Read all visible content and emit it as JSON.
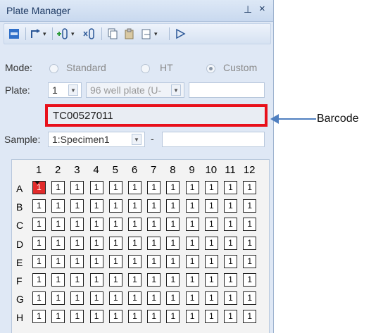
{
  "window": {
    "title": "Plate Manager",
    "pin_glyph": "ᵖ",
    "close_glyph": "×"
  },
  "toolbar": {
    "icons": [
      "plate-view-icon",
      "move-arrow-icon",
      "add-tube-icon",
      "remove-tube-icon",
      "copy-icon",
      "paste-icon",
      "clipboard-icon",
      "play-icon"
    ]
  },
  "mode": {
    "label": "Mode:",
    "options": [
      "Standard",
      "HT",
      "Custom"
    ],
    "selected": "Custom"
  },
  "plate": {
    "label": "Plate:",
    "number": "1",
    "type": "96 well plate (U-",
    "extra": ""
  },
  "barcode": {
    "value": "TC00527011"
  },
  "sample": {
    "label": "Sample:",
    "value": "1:Specimen1",
    "dash": "-",
    "extra": ""
  },
  "grid": {
    "columns": [
      "1",
      "2",
      "3",
      "4",
      "5",
      "6",
      "7",
      "8",
      "9",
      "10",
      "11",
      "12"
    ],
    "rows": [
      "A",
      "B",
      "C",
      "D",
      "E",
      "F",
      "G",
      "H"
    ],
    "well_value": "1",
    "selected_well": "A1"
  },
  "annotation": {
    "label": "Barcode",
    "color": "#4f7fc0",
    "highlight_color": "#e8101b"
  }
}
